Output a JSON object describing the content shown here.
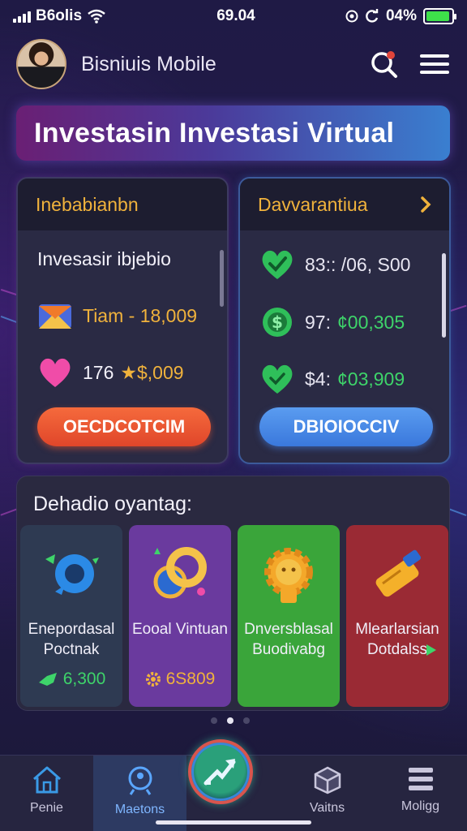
{
  "status_bar": {
    "carrier": "B6olis",
    "time": "69.04",
    "battery_text": "04%",
    "battery_level": 0.94,
    "icons": [
      "signal-icon",
      "wifi-icon",
      "target-icon",
      "sync-icon",
      "battery-icon"
    ]
  },
  "header": {
    "app_name": "Bisniuis Mobile",
    "icons": [
      "avatar",
      "search-icon",
      "menu-icon"
    ]
  },
  "banner": {
    "title": "Investasin Investasi Virtual"
  },
  "left_panel": {
    "title": "Inebabianbn",
    "subtitle": "Invesasir ibjebio",
    "rows": [
      {
        "icon": "envelope-icon",
        "text": "Tiam - 18,009",
        "color": "#f0b23c"
      },
      {
        "icon": "heart-icon",
        "prefix": "176",
        "text": "★$,009",
        "color": "#f0b23c"
      }
    ],
    "button_label": "OECDCOTCIM"
  },
  "right_panel": {
    "title": "Davvarantiua",
    "rows": [
      {
        "icon": "check-shield-icon",
        "text": "83:: /06, S00",
        "color": "#e8e6f2"
      },
      {
        "icon": "dollar-coin-icon",
        "prefix": "97:",
        "text": "¢00,305",
        "color": "#3ed46a"
      },
      {
        "icon": "heart-check-icon",
        "prefix": "$4:",
        "text": "¢03,909",
        "color": "#3ed46a"
      }
    ],
    "button_label": "DBIOIOCCIV"
  },
  "featured": {
    "title": "Dehadio oyantag:",
    "cards": [
      {
        "name": "Enepordasal Poctnak",
        "value": "6,300",
        "value_icon": "green-arrow-icon",
        "icon": "blue-pin-icon",
        "bg": "#2e3a52",
        "value_color": "#3ed46a"
      },
      {
        "name": "Eooal Vintuan",
        "value": "6S809",
        "value_icon": "orange-gear-icon",
        "icon": "yellow-rings-icon",
        "bg": "#6a3a9e",
        "value_color": "#f0b23c"
      },
      {
        "name": "Dnversblasal Buodivabg",
        "value": "",
        "value_icon": "",
        "icon": "gear-face-icon",
        "bg": "#3aa53a",
        "value_color": "#ffffff"
      },
      {
        "name": "Mlearlarsian Dotdalss",
        "value": "",
        "value_icon": "play-icon",
        "icon": "yellow-tool-icon",
        "bg": "#9a2a34",
        "value_color": "#ffffff"
      }
    ],
    "page_dots": 3,
    "active_dot": 1
  },
  "bottom_nav": {
    "items": [
      {
        "label": "Penie",
        "icon": "home-icon"
      },
      {
        "label": "Maetons",
        "icon": "search-person-icon",
        "active": true
      },
      {
        "label": "",
        "icon": "trend-fab-icon"
      },
      {
        "label": "Vaitns",
        "icon": "cube-icon"
      },
      {
        "label": "Moligg",
        "icon": "list-icon"
      }
    ]
  }
}
